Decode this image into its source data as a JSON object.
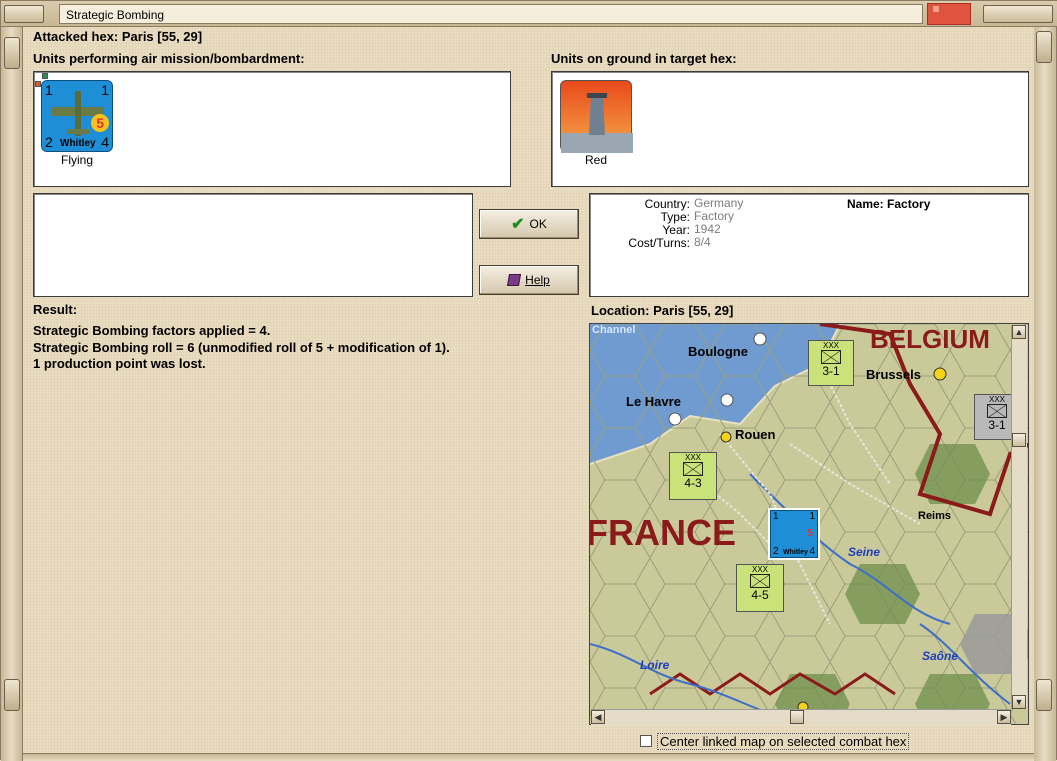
{
  "window": {
    "title": "Strategic Bombing"
  },
  "header": {
    "attacked_hex": "Attacked hex: Paris  [55, 29]"
  },
  "air_units": {
    "heading": "Units performing air mission/bombardment:",
    "units": [
      {
        "name": "Whitley",
        "top_left": "1",
        "top_right": "1",
        "bottom_left": "2",
        "bottom_right": "4",
        "badge": "5",
        "caption": "Flying"
      }
    ]
  },
  "ground_units": {
    "heading": "Units on ground in target hex:",
    "units": [
      {
        "icon": "factory-icon",
        "caption": "Red"
      }
    ]
  },
  "buttons": {
    "ok": "OK",
    "help": "Help"
  },
  "target_info": {
    "country_label": "Country:",
    "country": "Germany",
    "type_label": "Type:",
    "type": "Factory",
    "year_label": "Year:",
    "year": "1942",
    "cost_label": "Cost/Turns:",
    "cost": "8/4",
    "name": "Name: Factory"
  },
  "result": {
    "heading": "Result:",
    "lines": [
      "Strategic Bombing factors applied = 4.",
      "Strategic Bombing roll = 6 (unmodified roll of 5 + modification of 1).",
      "1 production point was lost."
    ]
  },
  "location": {
    "heading": "Location:  Paris  [55, 29]"
  },
  "map": {
    "countries": [
      "BELGIUM",
      "FRANCE"
    ],
    "cities": [
      "Boulogne",
      "Brussels",
      "Le Havre",
      "Rouen",
      "Reims"
    ],
    "rivers": [
      "Seine",
      "Loire",
      "Saône"
    ],
    "sea_label": "Channel",
    "counters": [
      {
        "label": "3-1",
        "size": "XXX",
        "color": "#c9e37a"
      },
      {
        "label": "3-1",
        "size": "XXX",
        "color": "#b9b9b9"
      },
      {
        "label": "4-3",
        "size": "XXX",
        "color": "#c9e37a"
      },
      {
        "label": "4-5",
        "size": "XXX",
        "color": "#c9e37a"
      }
    ],
    "map_unit": {
      "name": "Whitley",
      "badge": "5",
      "top_left": "1",
      "top_right": "1",
      "bottom_left": "2",
      "bottom_right": "4"
    }
  },
  "options": {
    "center_map": "Center linked map on selected combat hex"
  },
  "colors": {
    "sea": "#6f9bd1",
    "land": "#c9c99a",
    "border": "#8b1a1a",
    "counter_green": "#c9e37a",
    "air_unit_blue": "#1e8fd6"
  }
}
